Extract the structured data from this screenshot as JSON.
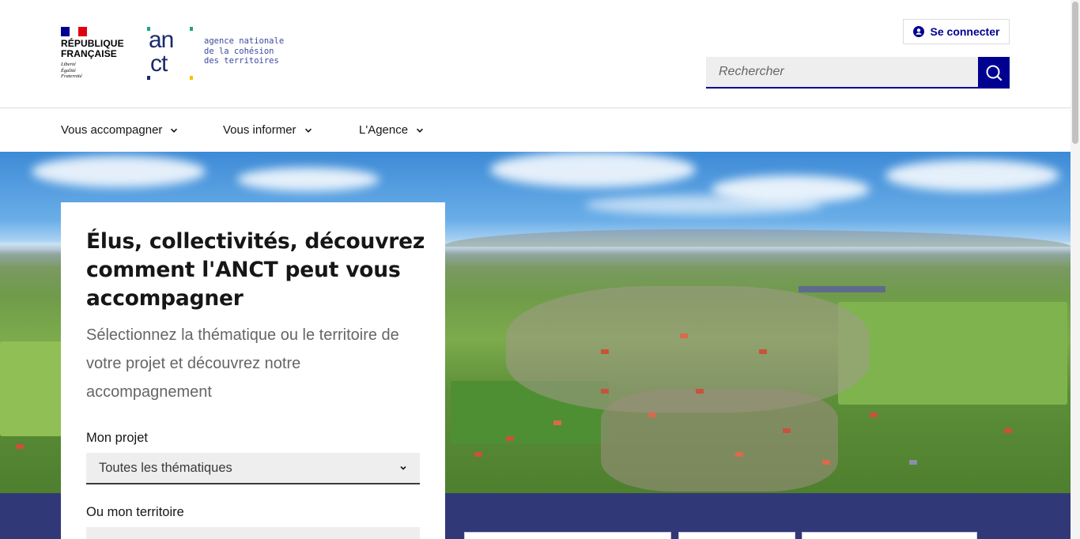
{
  "header": {
    "republique": {
      "line1": "RÉPUBLIQUE",
      "line2": "FRANÇAISE",
      "motto1": "Liberté",
      "motto2": "Égalité",
      "motto3": "Fraternité"
    },
    "anct": {
      "mark_top": "an",
      "mark_bottom": "ct",
      "line1": "agence nationale",
      "line2": "de la cohésion",
      "line3": "des territoires"
    },
    "login_label": "Se connecter",
    "search": {
      "placeholder": "Rechercher"
    }
  },
  "nav": {
    "items": [
      {
        "label": "Vous accompagner"
      },
      {
        "label": "Vous informer"
      },
      {
        "label": "L'Agence"
      }
    ]
  },
  "hero": {
    "title": "Élus, collectivités, découvrez comment l'ANCT peut vous accompagner",
    "lead": "Sélectionnez la thématique ou le territoire de votre projet et découvrez notre accompagnement",
    "project_label": "Mon projet",
    "project_value": "Toutes les thématiques",
    "territory_label": "Ou mon territoire"
  },
  "colors": {
    "primary_blue": "#000091",
    "band_blue": "#313878",
    "flag_blue": "#000091",
    "flag_red": "#e1000f"
  }
}
